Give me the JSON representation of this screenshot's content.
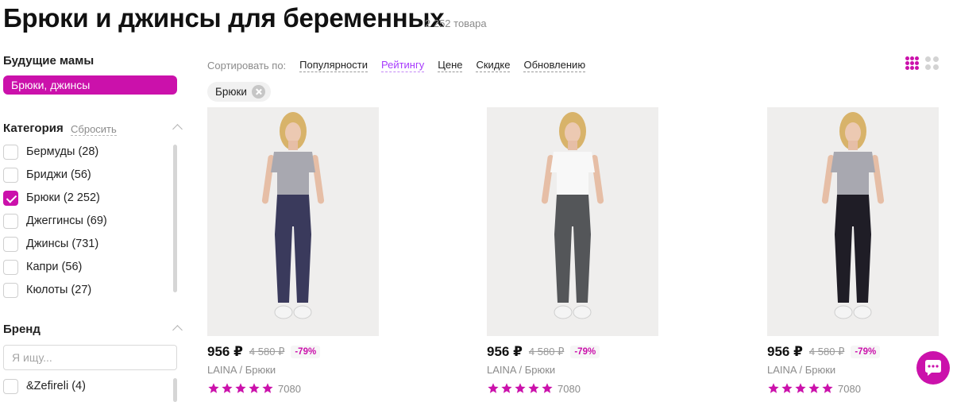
{
  "header": {
    "title": "Брюки и джинсы для беременных",
    "count": "2 252 товара"
  },
  "sidebar": {
    "section_title": "Будущие мамы",
    "active_chip": "Брюки, джинсы",
    "category": {
      "title": "Категория",
      "reset_label": "Сбросить",
      "items": [
        {
          "label": "Бермуды (28)",
          "checked": false
        },
        {
          "label": "Бриджи (56)",
          "checked": false
        },
        {
          "label": "Брюки (2 252)",
          "checked": true
        },
        {
          "label": "Джеггинсы (69)",
          "checked": false
        },
        {
          "label": "Джинсы (731)",
          "checked": false
        },
        {
          "label": "Капри (56)",
          "checked": false
        },
        {
          "label": "Кюлоты (27)",
          "checked": false
        }
      ]
    },
    "brand": {
      "title": "Бренд",
      "search_placeholder": "Я ищу...",
      "items": [
        {
          "label": "&Zefireli (4)",
          "checked": false
        }
      ]
    }
  },
  "sort": {
    "label": "Сортировать по:",
    "options": [
      "Популярности",
      "Рейтингу",
      "Цене",
      "Скидке",
      "Обновлению"
    ],
    "active": "Рейтингу"
  },
  "filters": {
    "tags": [
      {
        "label": "Брюки"
      }
    ]
  },
  "products": [
    {
      "price": "956 ₽",
      "old_price": "4 580 ₽",
      "discount": "-79%",
      "brand_name": "LAINA / Брюки",
      "rating": 5,
      "reviews": "7080",
      "top_color": "#a8a8b0",
      "pants_color": "#3a3a5c"
    },
    {
      "price": "956 ₽",
      "old_price": "4 580 ₽",
      "discount": "-79%",
      "brand_name": "LAINA / Брюки",
      "rating": 5,
      "reviews": "7080",
      "top_color": "#f8f8f8",
      "pants_color": "#545659"
    },
    {
      "price": "956 ₽",
      "old_price": "4 580 ₽",
      "discount": "-79%",
      "brand_name": "LAINA / Брюки",
      "rating": 5,
      "reviews": "7080",
      "top_color": "#a8a8b0",
      "pants_color": "#1f1d26"
    }
  ],
  "colors": {
    "accent": "#cb11ab",
    "sort_active": "#a73afd",
    "star": "#cb11ab",
    "muted_text": "#8b8b8b"
  },
  "icons": {
    "chat": "chat-bubble-icon",
    "tag_close": "close-icon",
    "collapse": "chevron-up-icon"
  }
}
